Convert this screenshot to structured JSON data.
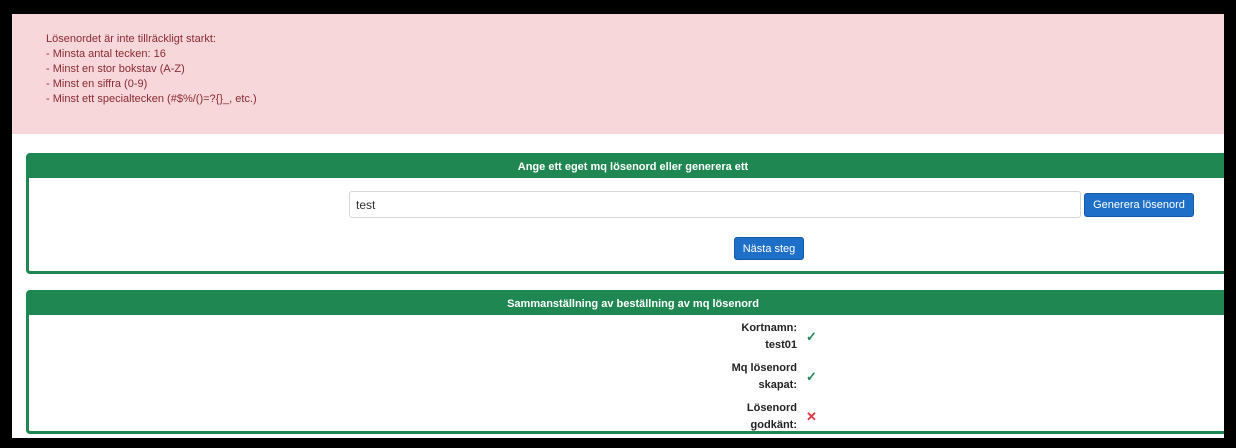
{
  "alert": {
    "title": "Lösenordet är inte tillräckligt starkt:",
    "rules": [
      "- Minsta antal tecken: 16",
      "- Minst en stor bokstav (A-Z)",
      "- Minst en siffra (0-9)",
      "- Minst ett specialtecken (#$%/()=?{}_, etc.)"
    ]
  },
  "password_card": {
    "header": "Ange ett eget mq lösenord eller generera ett",
    "input_value": "test",
    "generate_label": "Generera lösenord",
    "next_label": "Nästa steg"
  },
  "summary_card": {
    "header": "Sammanställning av beställning av mq lösenord",
    "rows": [
      {
        "label_line1": "Kortnamn:",
        "label_line2": "test01",
        "status": "ok",
        "icon": "✓"
      },
      {
        "label_line1": "Mq lösenord",
        "label_line2": "skapat:",
        "status": "ok",
        "icon": "✓"
      },
      {
        "label_line1": "Lösenord",
        "label_line2": "godkänt:",
        "status": "fail",
        "icon": "✕"
      }
    ]
  },
  "colors": {
    "accent_green": "#1e8752",
    "button_blue": "#1e6fc7",
    "alert_bg": "#f8d7da",
    "alert_text": "#8b2a33",
    "error_red": "#d9363e"
  }
}
